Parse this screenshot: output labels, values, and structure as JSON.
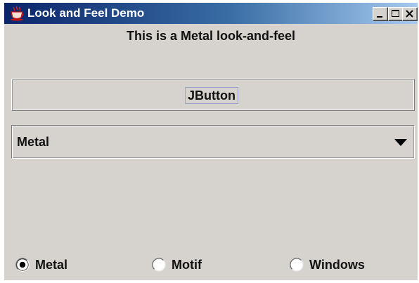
{
  "window": {
    "title": "Look and Feel Demo",
    "icon": "java-cup-icon",
    "controls": {
      "minimize": "minimize-icon",
      "maximize": "maximize-icon",
      "close": "close-icon"
    }
  },
  "content": {
    "heading": "This is a Metal look-and-feel",
    "button_label": "JButton",
    "combo": {
      "selected": "Metal",
      "arrow_icon": "triangle-down-icon"
    },
    "radios": [
      {
        "label": "Metal",
        "selected": true
      },
      {
        "label": "Motif",
        "selected": false
      },
      {
        "label": "Windows",
        "selected": false
      }
    ]
  }
}
